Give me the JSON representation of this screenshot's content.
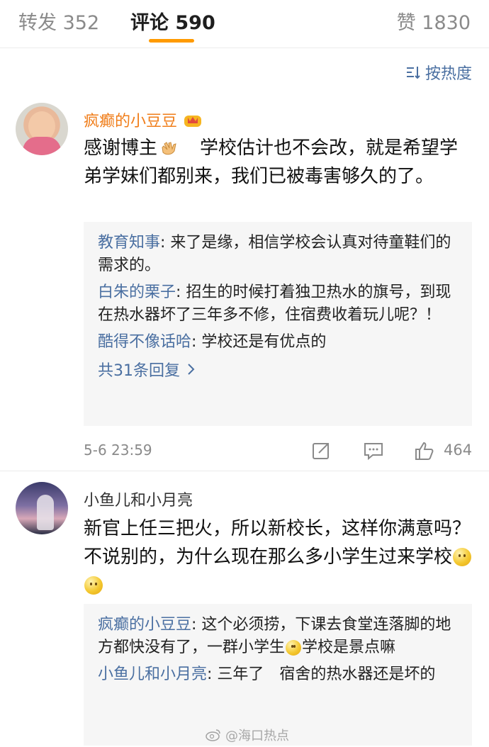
{
  "tabs": {
    "forward": "转发 352",
    "comments": "评论 590",
    "likes": "赞 1830"
  },
  "sort": {
    "label": "按热度"
  },
  "colors": {
    "accent": "#ff9a00",
    "link": "#4a6fa1",
    "vip_name": "#f07d19"
  },
  "comments": [
    {
      "username": "疯癫的小豆豆",
      "text_a": "感谢博主",
      "text_b": "学校估计也不会改，就是希望学弟学妹们都别来，我们已被毒害够久的了。",
      "replies": [
        {
          "who": "教育知事",
          "text": ": 来了是缘，相信学校会认真对待童鞋们的需求的。"
        },
        {
          "who": "白朱的栗子",
          "text": ": 招生的时候打着独卫热水的旗号，到现在热水器坏了三年多不修，住宿费收着玩儿呢？！"
        },
        {
          "who": "酷得不像话哈",
          "text": ": 学校还是有优点的"
        }
      ],
      "more": "共31条回复",
      "time": "5-6 23:59",
      "likes": "464"
    },
    {
      "username": "小鱼儿和小月亮",
      "text": "新官上任三把火，所以新校长，这样你满意吗？不说别的，为什么现在那么多小学生过来学校",
      "replies": [
        {
          "who": "疯癫的小豆豆",
          "text_a": ": 这个必须捞，下课去食堂连落脚的地方都快没有了，一群小学生",
          "text_b": "学校是景点嘛"
        },
        {
          "who": "小鱼儿和小月亮",
          "text": ": 三年了　宿舍的热水器还是坏的"
        }
      ]
    }
  ],
  "watermark": "@海口热点"
}
